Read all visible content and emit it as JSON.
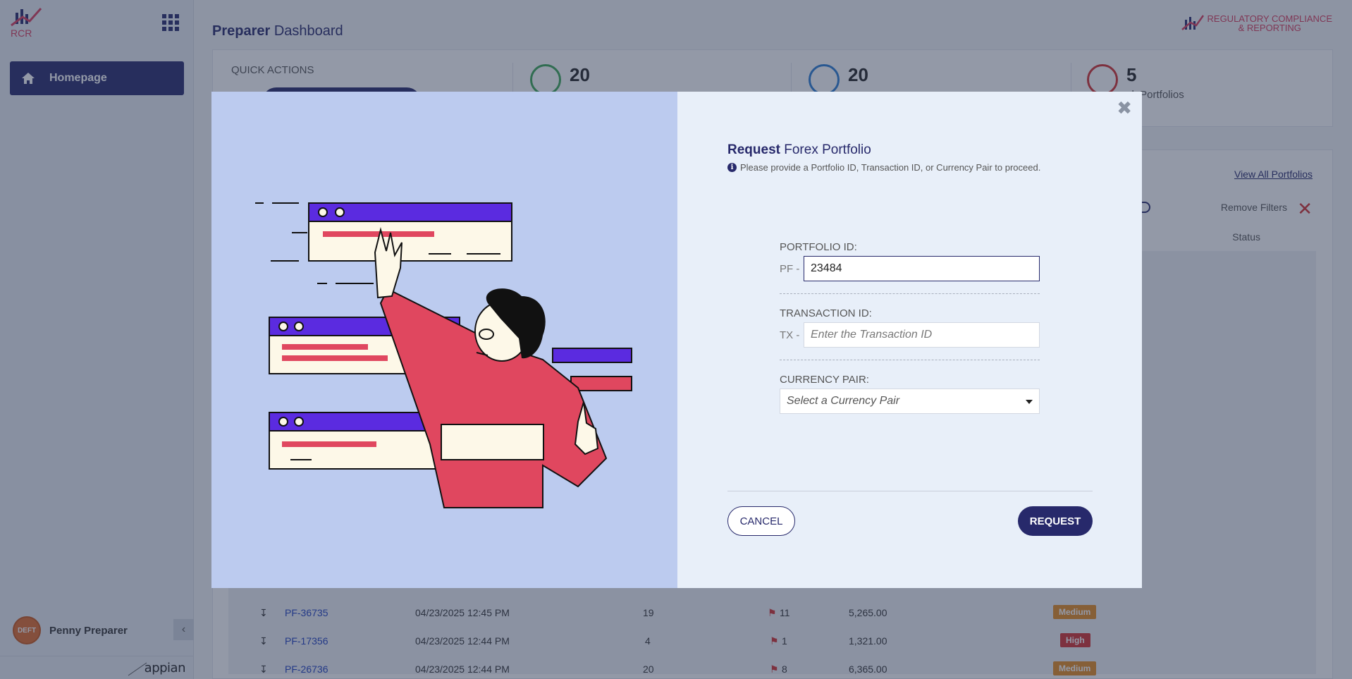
{
  "app": {
    "logo_text": "RCR",
    "page_title_bold": "Preparer",
    "page_title_rest": " Dashboard",
    "brand_line1": "REGULATORY COMPLIANCE",
    "brand_line2": "& REPORTING",
    "accent": "#27296b"
  },
  "sidebar": {
    "home_label": "Homepage",
    "user_name": "Penny Preparer",
    "avatar_text": "DEFT",
    "footer_brand": "appian"
  },
  "stats": {
    "quick_actions_label": "QUICK ACTIONS",
    "items": [
      {
        "value": "20",
        "label": ""
      },
      {
        "value": "20",
        "label": ""
      },
      {
        "value": "5",
        "label": "sk Portfolios"
      }
    ]
  },
  "table": {
    "view_all": "View All Portfolios",
    "remove_filters": "Remove Filters",
    "status_header": "Status",
    "rows": [
      {
        "id": "PF-36735",
        "date": "04/23/2025 12:45 PM",
        "count": "19",
        "flags": "11",
        "amount": "5,265.00",
        "risk": "Medium",
        "risk_color": "#e58a1f"
      },
      {
        "id": "PF-17356",
        "date": "04/23/2025 12:44 PM",
        "count": "4",
        "flags": "1",
        "amount": "1,321.00",
        "risk": "High",
        "risk_color": "#d32f2f"
      },
      {
        "id": "PF-26736",
        "date": "04/23/2025 12:44 PM",
        "count": "20",
        "flags": "8",
        "amount": "6,365.00",
        "risk": "Medium",
        "risk_color": "#e58a1f"
      }
    ]
  },
  "modal": {
    "title_bold": "Request",
    "title_rest": " Forex Portfolio",
    "hint": "Please provide a Portfolio ID, Transaction ID, or Currency Pair to proceed.",
    "portfolio_label": "PORTFOLIO ID:",
    "portfolio_prefix": "PF -",
    "portfolio_value": "23484",
    "transaction_label": "TRANSACTION ID:",
    "transaction_prefix": "TX -",
    "transaction_placeholder": "Enter the Transaction ID",
    "currency_label": "CURRENCY PAIR:",
    "currency_placeholder": "Select a Currency Pair",
    "cancel_label": "CANCEL",
    "request_label": "REQUEST"
  }
}
